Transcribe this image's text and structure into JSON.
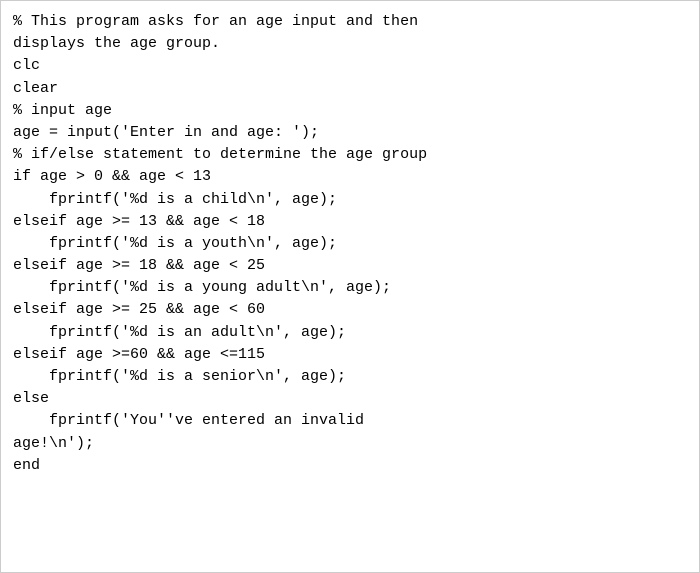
{
  "code": {
    "lines": [
      "% This program asks for an age input and then",
      "displays the age group.",
      "clc",
      "clear",
      "% input age",
      "age = input('Enter in and age: ');",
      "% if/else statement to determine the age group",
      "if age > 0 && age < 13",
      "    fprintf('%d is a child\\n', age);",
      "elseif age >= 13 && age < 18",
      "    fprintf('%d is a youth\\n', age);",
      "elseif age >= 18 && age < 25",
      "    fprintf('%d is a young adult\\n', age);",
      "elseif age >= 25 && age < 60",
      "    fprintf('%d is an adult\\n', age);",
      "elseif age >=60 && age <=115",
      "    fprintf('%d is a senior\\n', age);",
      "else",
      "    fprintf('You''ve entered an invalid",
      "age!\\n');",
      "end"
    ]
  }
}
